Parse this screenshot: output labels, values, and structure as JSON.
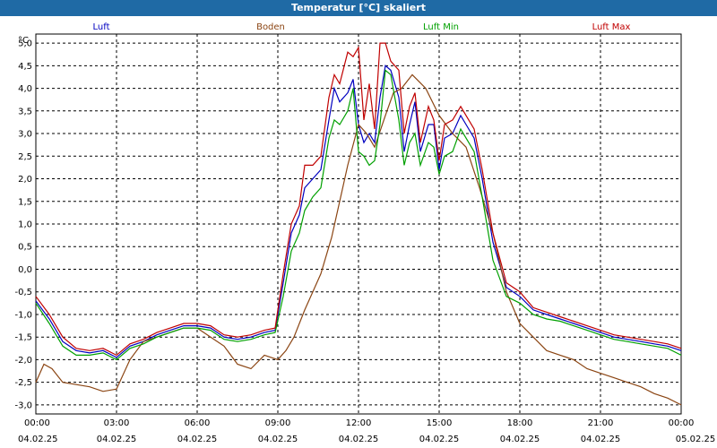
{
  "title": "Temperatur [°C] skaliert",
  "chart_data": {
    "type": "line",
    "title": "Temperatur [°C] skaliert",
    "xlabel": "",
    "ylabel": "°C",
    "ylim": [
      -3.2,
      5.2
    ],
    "yticks": [
      5.0,
      4.5,
      4.0,
      3.5,
      3.0,
      2.5,
      2.0,
      1.5,
      1.0,
      0.5,
      0.0,
      -0.5,
      -1.0,
      -1.5,
      -2.0,
      -2.5,
      -3.0
    ],
    "ytick_labels": [
      "5,0",
      "4,5",
      "4,0",
      "3,5",
      "3,0",
      "2,5",
      "2,0",
      "1,5",
      "1,0",
      "0,5",
      "0,0",
      "-0,5",
      "-1,0",
      "-1,5",
      "-2,0",
      "-2,5",
      "-3,0"
    ],
    "xlim": [
      0,
      24
    ],
    "xticks": [
      0,
      3,
      6,
      9,
      12,
      15,
      18,
      21,
      24
    ],
    "xtick_time_labels": [
      "00:00",
      "03:00",
      "06:00",
      "09:00",
      "12:00",
      "15:00",
      "18:00",
      "21:00",
      "00:00"
    ],
    "xtick_date_labels": [
      "04.02.25",
      "04.02.25",
      "04.02.25",
      "04.02.25",
      "04.02.25",
      "04.02.25",
      "04.02.25",
      "04.02.25",
      "05.02.25"
    ],
    "grid": true,
    "legend_position": "top",
    "series": [
      {
        "name": "Luft",
        "color": "#0000c0",
        "x": [
          0,
          0.5,
          1,
          1.5,
          2,
          2.5,
          3,
          3.5,
          4,
          4.5,
          5,
          5.5,
          6,
          6.5,
          7,
          7.5,
          8,
          8.5,
          8.9,
          9.2,
          9.5,
          9.8,
          10,
          10.3,
          10.6,
          10.9,
          11.1,
          11.3,
          11.6,
          11.8,
          12,
          12.2,
          12.4,
          12.6,
          12.8,
          13,
          13.2,
          13.5,
          13.7,
          13.9,
          14.1,
          14.3,
          14.6,
          14.8,
          15,
          15.2,
          15.5,
          15.8,
          16,
          16.3,
          16.6,
          17,
          17.5,
          18,
          18.5,
          19,
          19.5,
          20,
          20.5,
          21,
          21.5,
          22,
          22.5,
          23,
          23.5,
          24
        ],
        "y": [
          -0.7,
          -1.1,
          -1.6,
          -1.8,
          -1.85,
          -1.8,
          -1.95,
          -1.7,
          -1.6,
          -1.45,
          -1.35,
          -1.25,
          -1.25,
          -1.3,
          -1.5,
          -1.55,
          -1.5,
          -1.4,
          -1.35,
          -0.3,
          0.8,
          1.2,
          1.8,
          2.0,
          2.2,
          3.3,
          4.0,
          3.7,
          3.9,
          4.2,
          3.2,
          2.8,
          3.0,
          2.8,
          3.8,
          4.5,
          4.4,
          3.8,
          2.6,
          3.2,
          3.7,
          2.6,
          3.2,
          3.2,
          2.2,
          2.9,
          3.0,
          3.4,
          3.2,
          2.9,
          2.0,
          0.6,
          -0.4,
          -0.6,
          -0.9,
          -1.0,
          -1.1,
          -1.2,
          -1.3,
          -1.4,
          -1.5,
          -1.55,
          -1.6,
          -1.65,
          -1.7,
          -1.8
        ]
      },
      {
        "name": "Boden",
        "color": "#8b4513",
        "x": [
          0,
          0.3,
          0.6,
          1,
          1.5,
          2,
          2.5,
          3,
          3.5,
          4,
          4.5,
          5,
          5.5,
          6,
          6.5,
          7,
          7.5,
          8,
          8.5,
          9,
          9.3,
          9.6,
          10,
          10.3,
          10.6,
          11,
          11.3,
          11.6,
          12,
          12.3,
          12.6,
          13,
          13.3,
          13.6,
          14,
          14.5,
          15,
          15.5,
          16,
          16.5,
          17,
          17.5,
          18,
          18.5,
          19,
          19.5,
          20,
          20.5,
          21,
          21.5,
          22,
          22.5,
          23,
          23.5,
          24
        ],
        "y": [
          -2.5,
          -2.1,
          -2.2,
          -2.5,
          -2.55,
          -2.6,
          -2.7,
          -2.65,
          -2.0,
          -1.6,
          -1.5,
          -1.4,
          -1.3,
          -1.3,
          -1.5,
          -1.7,
          -2.1,
          -2.2,
          -1.9,
          -2.0,
          -1.8,
          -1.5,
          -0.9,
          -0.5,
          -0.1,
          0.7,
          1.5,
          2.3,
          3.2,
          3.0,
          2.7,
          3.4,
          3.9,
          4.0,
          4.3,
          4.0,
          3.4,
          3.0,
          2.7,
          1.8,
          0.8,
          -0.5,
          -1.2,
          -1.5,
          -1.8,
          -1.9,
          -2.0,
          -2.2,
          -2.3,
          -2.4,
          -2.5,
          -2.6,
          -2.75,
          -2.85,
          -3.0
        ]
      },
      {
        "name": "Luft Min",
        "color": "#00a000",
        "x": [
          0,
          0.5,
          1,
          1.5,
          2,
          2.5,
          3,
          3.5,
          4,
          4.5,
          5,
          5.5,
          6,
          6.5,
          7,
          7.5,
          8,
          8.5,
          8.9,
          9.2,
          9.5,
          9.8,
          10,
          10.3,
          10.6,
          10.9,
          11.1,
          11.3,
          11.6,
          11.8,
          12,
          12.2,
          12.4,
          12.6,
          12.8,
          13,
          13.2,
          13.5,
          13.7,
          13.9,
          14.1,
          14.3,
          14.6,
          14.8,
          15,
          15.2,
          15.5,
          15.8,
          16,
          16.3,
          16.6,
          17,
          17.5,
          18,
          18.5,
          19,
          19.5,
          20,
          20.5,
          21,
          21.5,
          22,
          22.5,
          23,
          23.5,
          24
        ],
        "y": [
          -0.75,
          -1.2,
          -1.7,
          -1.9,
          -1.9,
          -1.85,
          -2.0,
          -1.75,
          -1.65,
          -1.5,
          -1.4,
          -1.3,
          -1.3,
          -1.35,
          -1.55,
          -1.6,
          -1.55,
          -1.45,
          -1.4,
          -0.6,
          0.4,
          0.8,
          1.3,
          1.6,
          1.8,
          2.9,
          3.3,
          3.2,
          3.5,
          4.0,
          2.6,
          2.5,
          2.3,
          2.4,
          3.2,
          4.4,
          4.3,
          3.3,
          2.3,
          2.8,
          3.0,
          2.3,
          2.8,
          2.7,
          2.1,
          2.5,
          2.6,
          3.1,
          2.9,
          2.6,
          1.6,
          0.2,
          -0.6,
          -0.75,
          -1.0,
          -1.1,
          -1.15,
          -1.25,
          -1.35,
          -1.45,
          -1.55,
          -1.6,
          -1.65,
          -1.7,
          -1.75,
          -1.9
        ]
      },
      {
        "name": "Luft Max",
        "color": "#c00000",
        "x": [
          0,
          0.5,
          1,
          1.5,
          2,
          2.5,
          3,
          3.5,
          4,
          4.5,
          5,
          5.5,
          6,
          6.5,
          7,
          7.5,
          8,
          8.5,
          8.9,
          9.2,
          9.5,
          9.8,
          10,
          10.3,
          10.6,
          10.9,
          11.1,
          11.3,
          11.6,
          11.8,
          12,
          12.2,
          12.4,
          12.6,
          12.8,
          13,
          13.2,
          13.5,
          13.7,
          13.9,
          14.1,
          14.3,
          14.6,
          14.8,
          15,
          15.2,
          15.5,
          15.8,
          16,
          16.3,
          16.6,
          17,
          17.5,
          18,
          18.5,
          19,
          19.5,
          20,
          20.5,
          21,
          21.5,
          22,
          22.5,
          23,
          23.5,
          24
        ],
        "y": [
          -0.6,
          -1.0,
          -1.5,
          -1.75,
          -1.8,
          -1.75,
          -1.9,
          -1.65,
          -1.55,
          -1.4,
          -1.3,
          -1.2,
          -1.2,
          -1.25,
          -1.45,
          -1.5,
          -1.45,
          -1.35,
          -1.3,
          -0.1,
          1.0,
          1.4,
          2.3,
          2.3,
          2.5,
          3.8,
          4.3,
          4.1,
          4.8,
          4.7,
          4.9,
          3.3,
          4.1,
          3.1,
          5.0,
          5.0,
          4.6,
          4.4,
          3.0,
          3.6,
          3.9,
          2.8,
          3.6,
          3.3,
          2.4,
          3.2,
          3.3,
          3.6,
          3.4,
          3.1,
          2.2,
          0.8,
          -0.3,
          -0.5,
          -0.85,
          -0.95,
          -1.05,
          -1.15,
          -1.25,
          -1.35,
          -1.45,
          -1.5,
          -1.55,
          -1.6,
          -1.65,
          -1.75
        ]
      }
    ]
  }
}
